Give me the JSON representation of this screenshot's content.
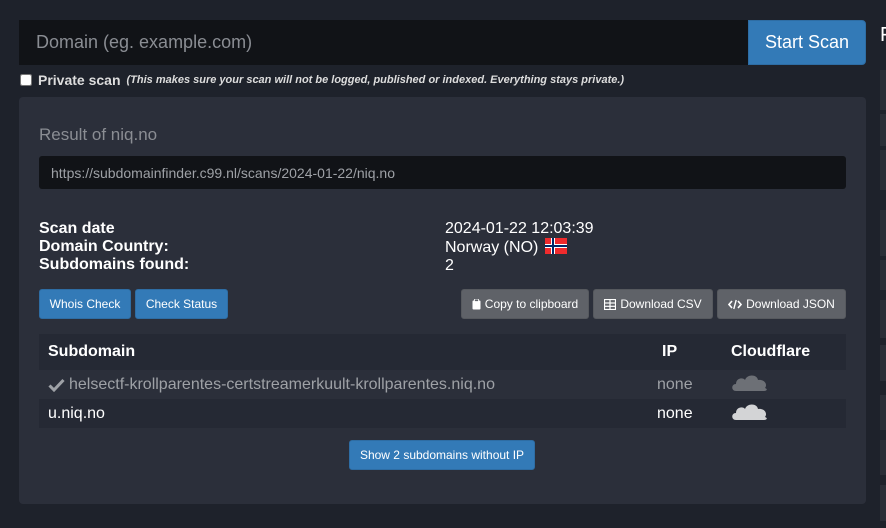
{
  "search": {
    "placeholder": "Domain (eg. example.com)",
    "start_label": "Start Scan"
  },
  "edge_char": "F",
  "private": {
    "label": "Private scan",
    "note": "(This makes sure your scan will not be logged, published or indexed. Everything stays private.)"
  },
  "result": {
    "title": "Result of niq.no",
    "url": "https://subdomainfinder.c99.nl/scans/2024-01-22/niq.no",
    "labels": {
      "scan_date": "Scan date",
      "country": "Domain Country:",
      "found": "Subdomains found:"
    },
    "values": {
      "scan_date": "2024-01-22 12:03:39",
      "country": "Norway (NO)",
      "found": "2"
    }
  },
  "buttons": {
    "whois": "Whois Check",
    "status": "Check Status",
    "copy": "Copy to clipboard",
    "csv": "Download CSV",
    "json": "Download JSON",
    "show": "Show 2 subdomains without IP"
  },
  "table": {
    "headers": {
      "subdomain": "Subdomain",
      "ip": "IP",
      "cloudflare": "Cloudflare"
    },
    "rows": [
      {
        "subdomain": "helsectf-krollparentes-certstreamerkuult-krollparentes.niq.no",
        "ip": "none",
        "checked": true
      },
      {
        "subdomain": "u.niq.no",
        "ip": "none",
        "checked": false
      }
    ]
  },
  "colors": {
    "background": "#1e222b",
    "panel": "#2b2f3a",
    "primary": "#337ab7",
    "secondary": "#5f6268"
  }
}
